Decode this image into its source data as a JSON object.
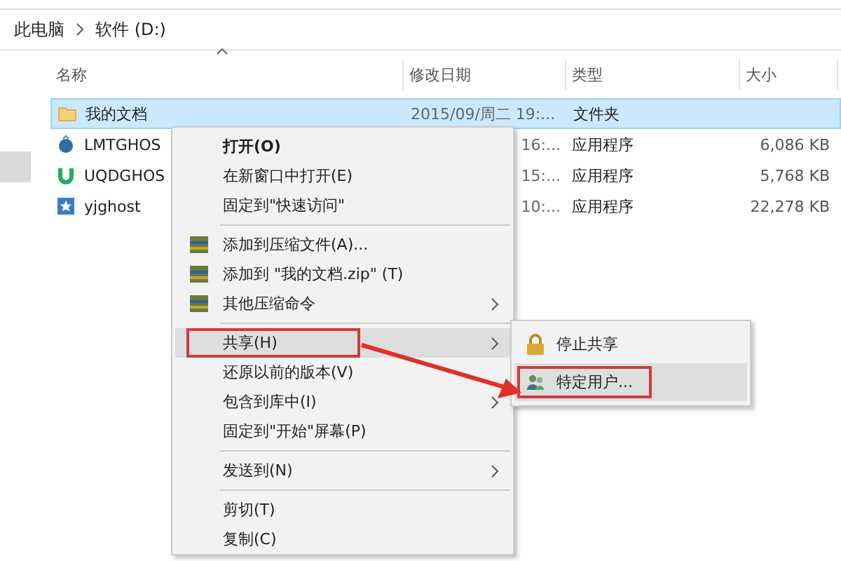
{
  "breadcrumb": {
    "items": [
      "此电脑",
      "软件 (D:)"
    ]
  },
  "table": {
    "columns": [
      "名称",
      "修改日期",
      "类型",
      "大小"
    ],
    "rows": [
      {
        "kind": "folder",
        "name": "我的文档",
        "date": "2015/09/周二 19:...",
        "type": "文件夹",
        "size": "",
        "selected": true
      },
      {
        "kind": "app",
        "name": "LMTGHOS",
        "date": "16:...",
        "type": "应用程序",
        "size": "6,086 KB",
        "selected": false
      },
      {
        "kind": "app",
        "name": "UQDGHOS",
        "date": "15:...",
        "type": "应用程序",
        "size": "5,768 KB",
        "selected": false
      },
      {
        "kind": "app",
        "name": "yjghost",
        "date": "10:...",
        "type": "应用程序",
        "size": "22,278 KB",
        "selected": false
      }
    ]
  },
  "context_menu": {
    "items": [
      {
        "kind": "item",
        "label": "打开(O)",
        "bold": true,
        "submenu": false,
        "selected": false,
        "marked": false
      },
      {
        "kind": "item",
        "label": "在新窗口中打开(E)",
        "bold": false,
        "submenu": false,
        "selected": false,
        "marked": false
      },
      {
        "kind": "item",
        "label": "固定到\"快速访问\"",
        "bold": false,
        "submenu": false,
        "selected": false,
        "marked": false
      },
      {
        "kind": "separator"
      },
      {
        "kind": "archive_item",
        "label": "添加到压缩文件(A)...",
        "bold": false,
        "submenu": false,
        "selected": false,
        "marked": false
      },
      {
        "kind": "archive_item",
        "label": "添加到 \"我的文档.zip\" (T)",
        "bold": false,
        "submenu": false,
        "selected": false,
        "marked": false
      },
      {
        "kind": "archive_item",
        "label": "其他压缩命令",
        "bold": false,
        "submenu": true,
        "selected": false,
        "marked": false
      },
      {
        "kind": "separator"
      },
      {
        "kind": "item",
        "label": "共享(H)",
        "bold": false,
        "submenu": true,
        "selected": true,
        "marked": true
      },
      {
        "kind": "item",
        "label": "还原以前的版本(V)",
        "bold": false,
        "submenu": false,
        "selected": false,
        "marked": false
      },
      {
        "kind": "item",
        "label": "包含到库中(I)",
        "bold": false,
        "submenu": true,
        "selected": false,
        "marked": false
      },
      {
        "kind": "item",
        "label": "固定到\"开始\"屏幕(P)",
        "bold": false,
        "submenu": false,
        "selected": false,
        "marked": false
      },
      {
        "kind": "separator"
      },
      {
        "kind": "item",
        "label": "发送到(N)",
        "bold": false,
        "submenu": true,
        "selected": false,
        "marked": false
      },
      {
        "kind": "separator"
      },
      {
        "kind": "item",
        "label": "剪切(T)",
        "bold": false,
        "submenu": false,
        "selected": false,
        "marked": false
      },
      {
        "kind": "item",
        "label": "复制(C)",
        "bold": false,
        "submenu": false,
        "selected": false,
        "marked": false
      }
    ]
  },
  "submenu": {
    "items": [
      {
        "label": "停止共享",
        "selected": false,
        "marked": false
      },
      {
        "label": "特定用户...",
        "selected": true,
        "marked": true
      }
    ]
  }
}
